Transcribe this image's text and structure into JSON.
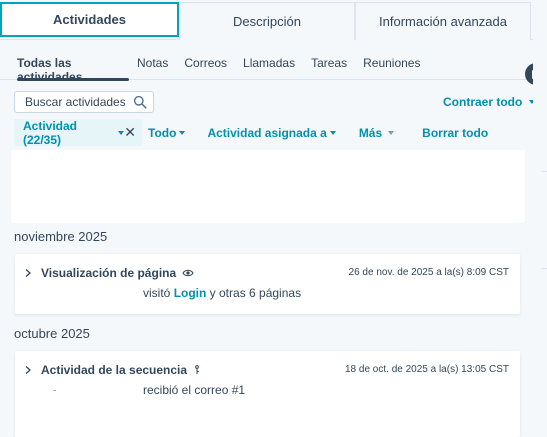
{
  "top_tabs": [
    {
      "label": "Actividades"
    },
    {
      "label": "Descripción"
    },
    {
      "label": "Información avanzada"
    }
  ],
  "sub_tabs": [
    {
      "label": "Todas las actividades"
    },
    {
      "label": "Notas"
    },
    {
      "label": "Correos"
    },
    {
      "label": "Llamadas"
    },
    {
      "label": "Tareas"
    },
    {
      "label": "Reuniones"
    }
  ],
  "search": {
    "placeholder": "Buscar actividades",
    "value": ""
  },
  "collapse_all_label": "Contraer todo",
  "filters": {
    "activity_pill": "Actividad (22/35)",
    "all_label": "Todo",
    "assigned_label": "Actividad asignada a",
    "more_label": "Más",
    "clear_label": "Borrar todo"
  },
  "groups": [
    {
      "month": "noviembre 2025",
      "title": "Visualización de página",
      "date": "26 de nov. de 2025 a la(s) 8:09 CST",
      "body_prefix": "visitó ",
      "body_link": "Login",
      "body_suffix": " y otras 6 páginas"
    },
    {
      "month": "octubre 2025",
      "title": "Actividad de la secuencia",
      "date": "18 de oct. de 2025 a la(s) 13:05 CST",
      "body_text": "recibió el correo #1"
    }
  ],
  "colors": {
    "accent": "#00a4bd",
    "link": "#0091ae",
    "text": "#33475b"
  }
}
